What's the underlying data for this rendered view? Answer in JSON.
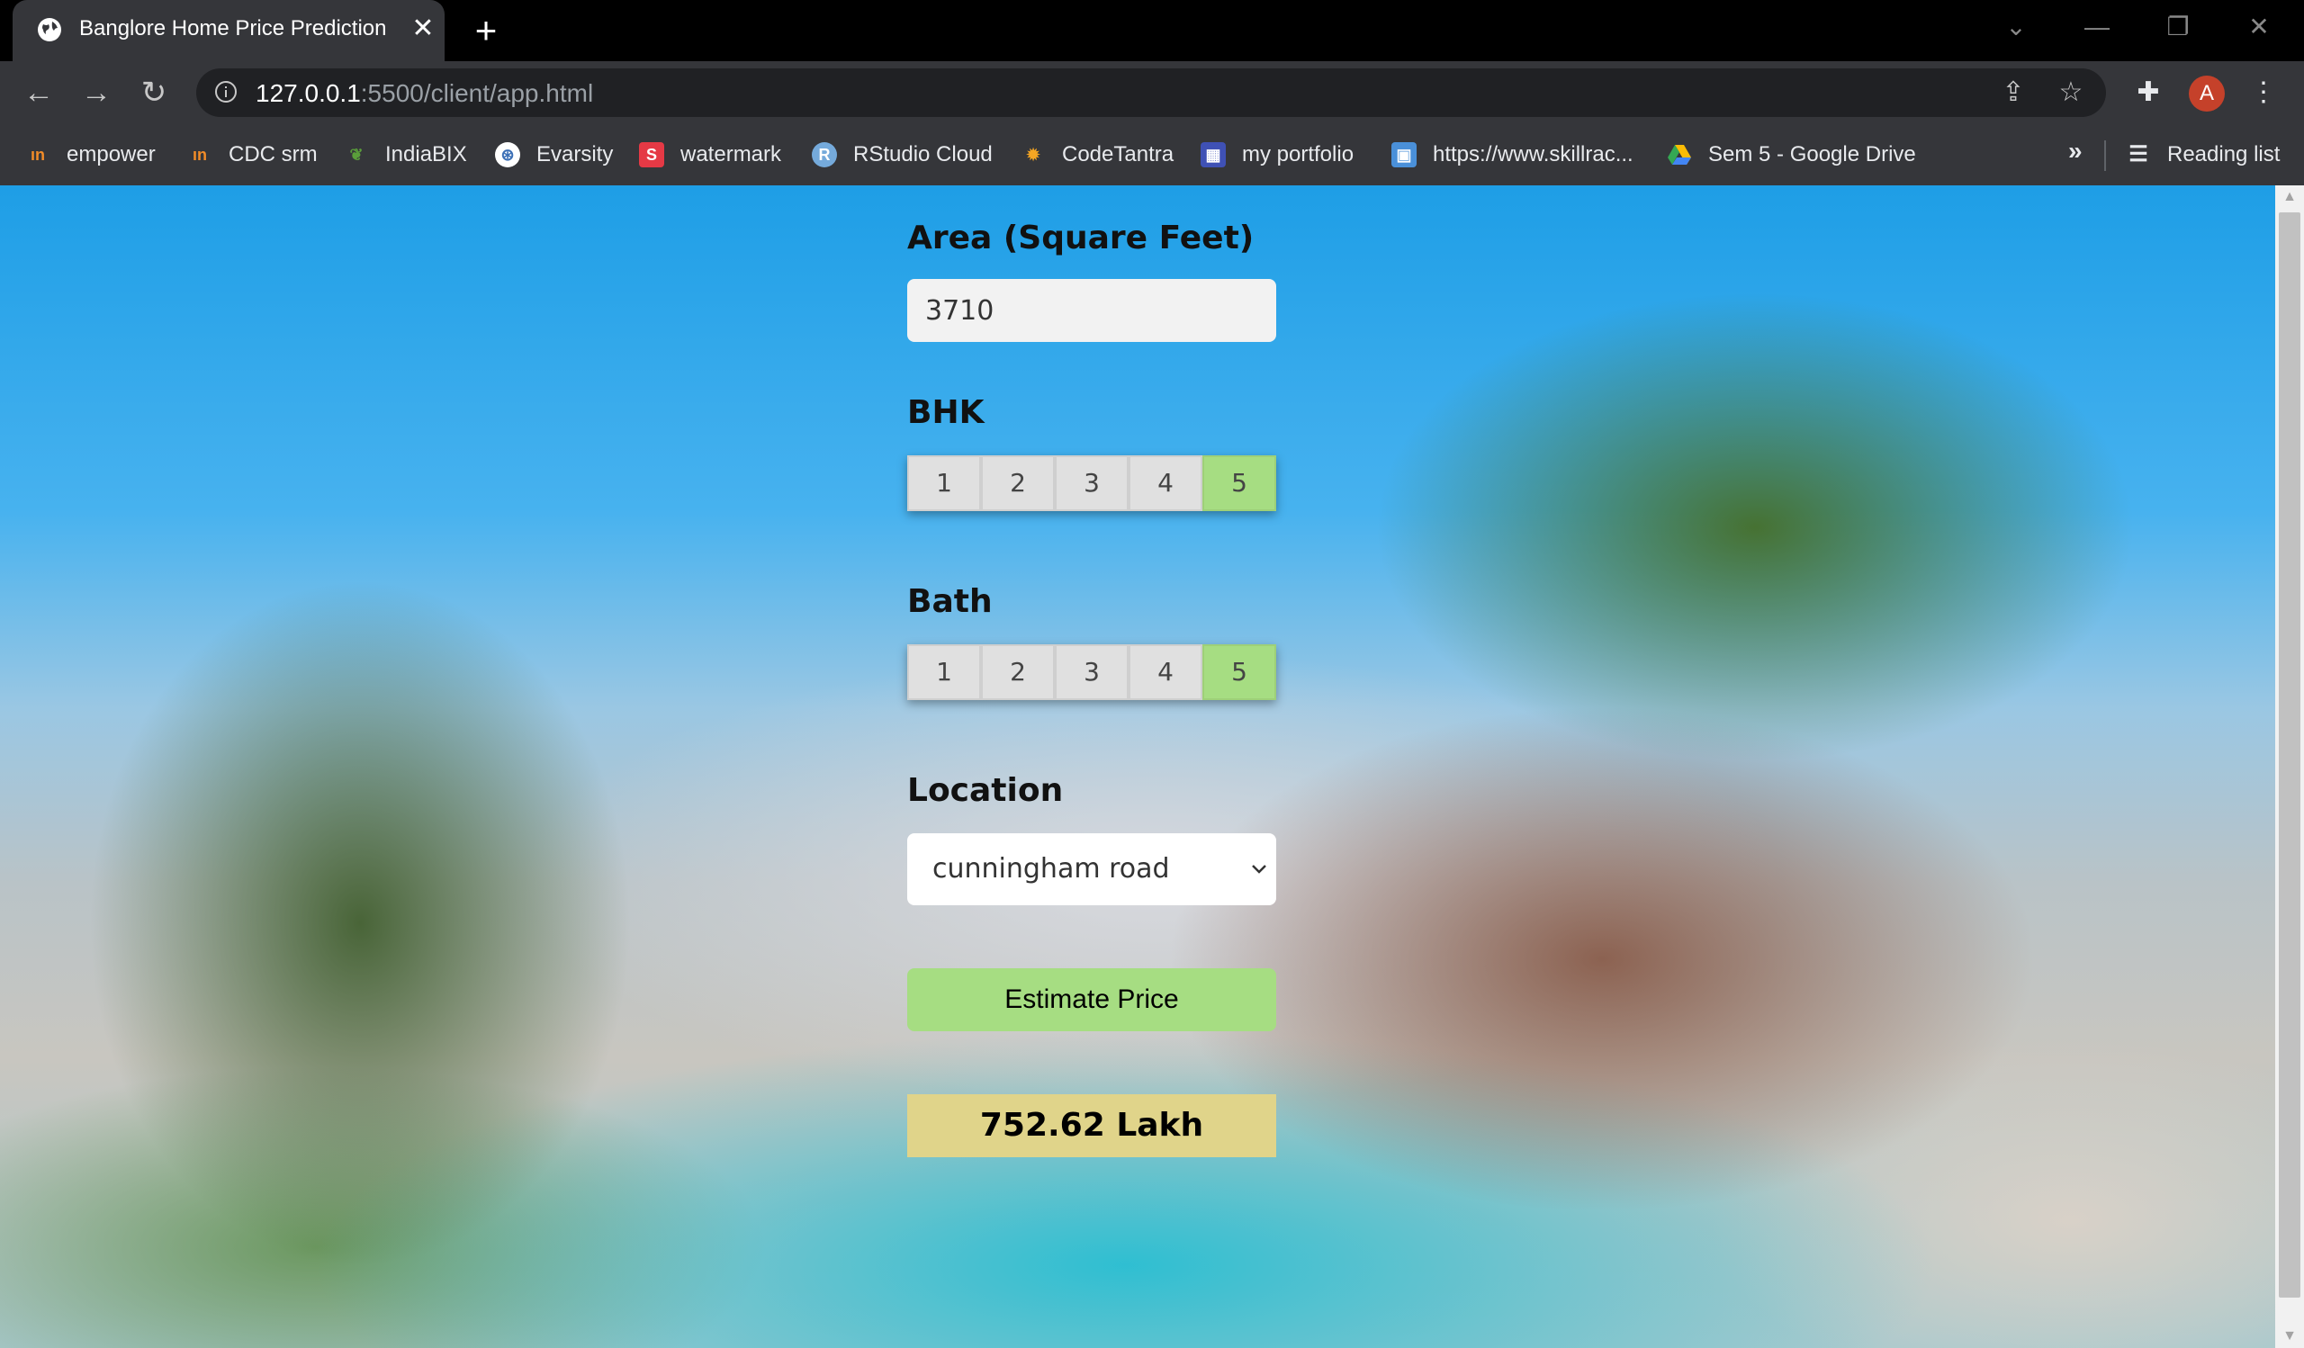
{
  "browser": {
    "tab_title": "Banglore Home Price Prediction",
    "url_host": "127.0.0.1",
    "url_rest": ":5500/client/app.html",
    "bookmarks": [
      {
        "label": "empower",
        "icon": "empower-icon",
        "color": "#f28c28"
      },
      {
        "label": "CDC srm",
        "icon": "cdc-srm-icon",
        "color": "#f28c28"
      },
      {
        "label": "IndiaBIX",
        "icon": "indiabix-icon",
        "color": "#3a7a2a"
      },
      {
        "label": "Evarsity",
        "icon": "evarsity-icon",
        "color": "#3b6fb6"
      },
      {
        "label": "watermark",
        "icon": "watermark-icon",
        "color": "#e53945"
      },
      {
        "label": "RStudio Cloud",
        "icon": "rstudio-icon",
        "color": "#75aadb"
      },
      {
        "label": "CodeTantra",
        "icon": "codetantra-icon",
        "color": "#f5a623"
      },
      {
        "label": "my portfolio",
        "icon": "portfolio-icon",
        "color": "#3f51b5"
      },
      {
        "label": "https://www.skillrac...",
        "icon": "skillrack-icon",
        "color": "#4a90d9"
      },
      {
        "label": "Sem 5 - Google Drive",
        "icon": "google-drive-icon",
        "color": "#34a853"
      }
    ],
    "reading_list": "Reading list",
    "avatar_initial": "A"
  },
  "form": {
    "area_label": "Area (Square Feet)",
    "area_value": "3710",
    "bhk_label": "BHK",
    "bhk_options": [
      "1",
      "2",
      "3",
      "4",
      "5"
    ],
    "bhk_selected": "5",
    "bath_label": "Bath",
    "bath_options": [
      "1",
      "2",
      "3",
      "4",
      "5"
    ],
    "bath_selected": "5",
    "location_label": "Location",
    "location_value": "cunningham road",
    "estimate_button": "Estimate Price",
    "result": "752.62 Lakh"
  },
  "colors": {
    "selected": "#a6dd82",
    "result_bg": "#e0d48a"
  }
}
